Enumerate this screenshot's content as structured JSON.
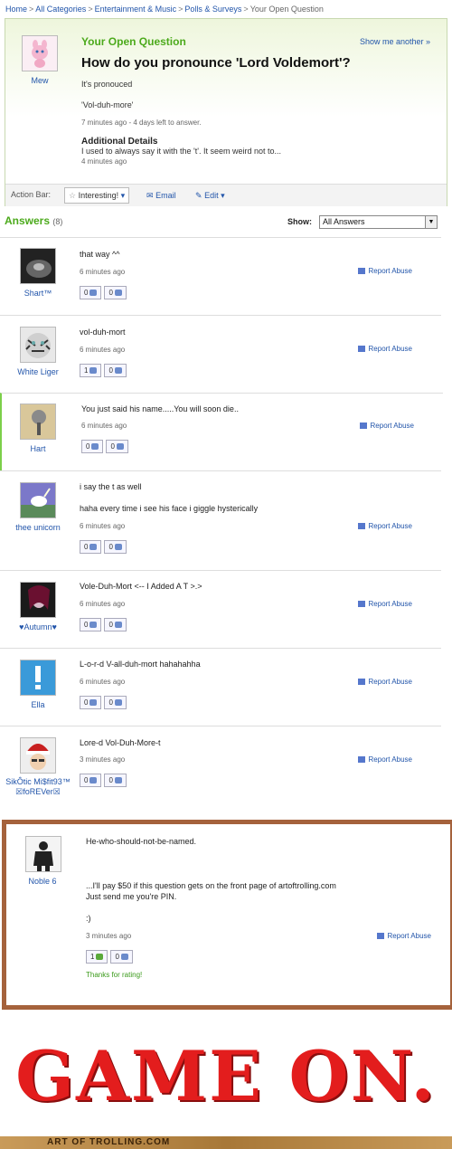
{
  "breadcrumb": {
    "items": [
      "Home",
      "All Categories",
      "Entertainment & Music",
      "Polls & Surveys"
    ],
    "current": "Your Open Question",
    "separator": ">"
  },
  "question": {
    "section_label": "Your Open Question",
    "show_another": "Show me another »",
    "asker": "Mew",
    "title": "How do you pronounce 'Lord Voldemort'?",
    "body_line1": "It's pronouced",
    "body_line2": "'Vol-duh-more'",
    "meta": "7 minutes ago - 4 days left to answer.",
    "details_label": "Additional Details",
    "details_text": "I used to always say it with the 't'. It seem weird not to...",
    "details_time": "4 minutes ago"
  },
  "action_bar": {
    "label": "Action Bar:",
    "interesting": "Interesting!",
    "email": "Email",
    "edit": "Edit"
  },
  "answers_header": {
    "title": "Answers",
    "count": "(8)",
    "show_label": "Show:",
    "show_value": "All Answers"
  },
  "report_label": "Report Abuse",
  "answers": [
    {
      "user": "Shart™",
      "lines": [
        "that way ^^"
      ],
      "time": "6 minutes ago",
      "up": "0",
      "down": "0"
    },
    {
      "user": "White Liger",
      "lines": [
        "vol-duh-mort"
      ],
      "time": "6 minutes ago",
      "up": "1",
      "down": "0"
    },
    {
      "user": "Hart",
      "lines": [
        "You just said his name.....You will soon die.."
      ],
      "time": "6 minutes ago",
      "up": "0",
      "down": "0"
    },
    {
      "user": "thee unicorn",
      "lines": [
        "i say the t as well",
        "haha every time i see his face i giggle hysterically"
      ],
      "time": "6 minutes ago",
      "up": "0",
      "down": "0"
    },
    {
      "user": "♥Autumn♥",
      "lines": [
        "Vole-Duh-Mort <-- I Added A T >.>"
      ],
      "time": "6 minutes ago",
      "up": "0",
      "down": "0"
    },
    {
      "user": "Ella",
      "lines": [
        "L-o-r-d V-all-duh-mort hahahahha"
      ],
      "time": "6 minutes ago",
      "up": "0",
      "down": "0"
    },
    {
      "user": "SikÔtic Mi$fit93™ ☒foREVer☒",
      "lines": [
        "Lore-d Vol-Duh-More-t"
      ],
      "time": "3 minutes ago",
      "up": "0",
      "down": "0"
    }
  ],
  "highlight_answer": {
    "user": "Noble 6",
    "line1": "He-who-should-not-be-named.",
    "line2": "...I'll pay $50 if this question gets on the front page of artoftrolling.com",
    "line3": "Just send me you're PIN.",
    "line4": ":)",
    "time": "3 minutes ago",
    "up": "1",
    "down": "0",
    "thanks": "Thanks for rating!"
  },
  "caption": "GAME ON.",
  "footer": "ART OF TROLLING.COM",
  "colors": {
    "accent_green": "#4caa1c",
    "link_blue": "#2255aa",
    "highlight_border": "#a5623c",
    "caption_red": "#e31d1d"
  }
}
